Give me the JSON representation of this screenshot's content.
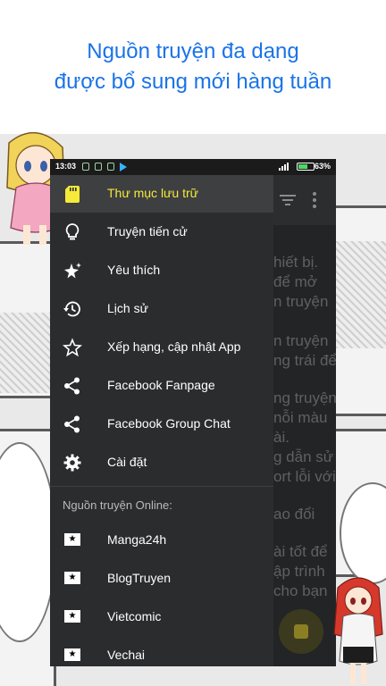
{
  "promo": {
    "line1": "Nguồn truyện đa dạng",
    "line2": "được bổ sung mới hàng tuần"
  },
  "status_bar": {
    "time": "13:03",
    "battery_pct": "63%",
    "battery_level": 0.63
  },
  "content_fragments": [
    "hiết bị.",
    "để mở",
    "n truyện",
    "n truyện",
    "ng trái để",
    "ng truyện",
    "nỗi màu",
    "ài.",
    "g dẫn sử",
    "ort lỗi với",
    "ao đổi",
    "ài tốt để",
    "ập trình",
    "cho bạn"
  ],
  "drawer": {
    "items": [
      {
        "label": "Thư mục lưu trữ",
        "icon": "sd-card-icon",
        "active": true
      },
      {
        "label": "Truyện tiến cử",
        "icon": "lightbulb-icon"
      },
      {
        "label": "Yêu thích",
        "icon": "star-sparkle-icon"
      },
      {
        "label": "Lịch sử",
        "icon": "history-icon"
      },
      {
        "label": "Xếp hạng, cập nhật App",
        "icon": "star-outline-icon"
      },
      {
        "label": "Facebook Fanpage",
        "icon": "share-icon"
      },
      {
        "label": "Facebook Group Chat",
        "icon": "share-icon"
      },
      {
        "label": "Cài đặt",
        "icon": "gear-icon"
      }
    ],
    "section_title": "Nguồn truyện Online:",
    "sources": [
      {
        "label": "Manga24h",
        "icon": "source-logo-icon"
      },
      {
        "label": "BlogTruyen",
        "icon": "source-logo-icon"
      },
      {
        "label": "Vietcomic",
        "icon": "source-logo-icon"
      },
      {
        "label": "Vechai",
        "icon": "source-logo-icon"
      }
    ]
  },
  "colors": {
    "promo_text": "#1a73e8",
    "drawer_bg": "#2a2c2e",
    "active_label": "#f5ea3a",
    "active_row": "#3d3f41"
  }
}
